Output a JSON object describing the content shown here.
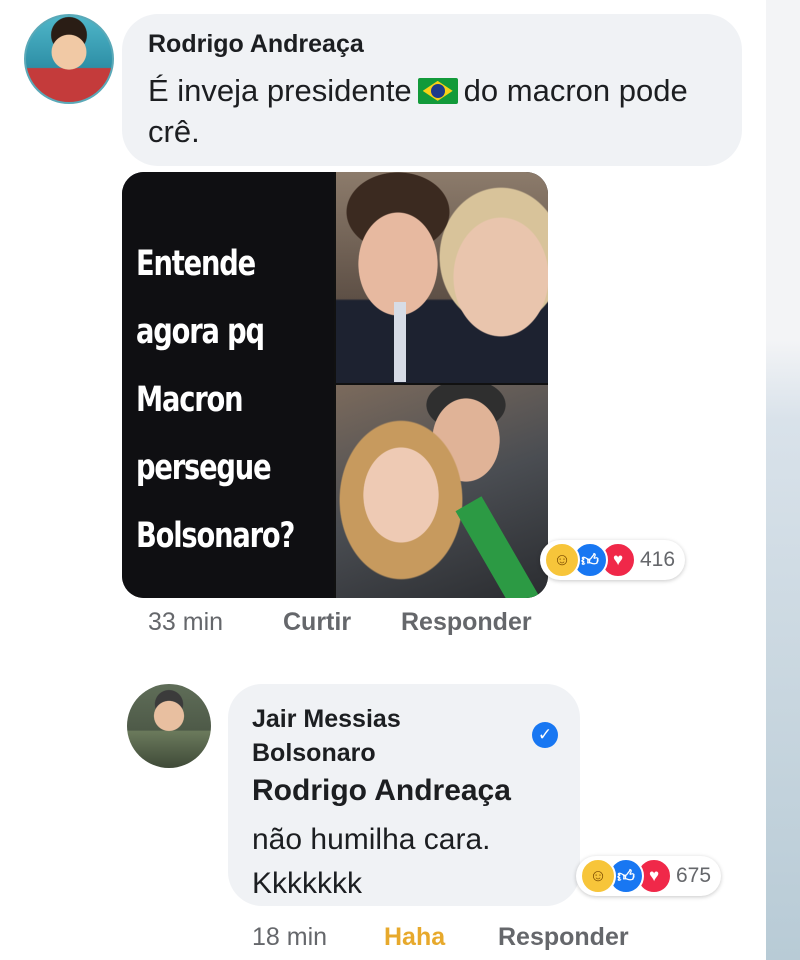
{
  "comment1": {
    "author": "Rodrigo Andreaça",
    "text_before_flag": "É inveja presidente",
    "flag_icon": "brazil-flag-icon",
    "text_after_flag": "do macron pode crê.",
    "meme_text": "Entende agora pq Macron persegue Bolsonaro?",
    "reactions": {
      "icons": [
        "haha-icon",
        "like-icon",
        "love-icon"
      ],
      "count": "416"
    },
    "time": "33 min",
    "like_label": "Curtir",
    "reply_label": "Responder"
  },
  "comment2": {
    "author": "Jair Messias Bolsonaro",
    "verified": true,
    "mention": "Rodrigo Andreaça",
    "text": "não humilha cara. Kkkkkkk",
    "reactions": {
      "icons": [
        "haha-icon",
        "like-icon",
        "love-icon"
      ],
      "count": "675"
    },
    "time": "18 min",
    "reaction_label": "Haha",
    "reply_label": "Responder"
  },
  "colors": {
    "bubble": "#f0f2f5",
    "haha_active": "#e7a92c",
    "like_blue": "#1877f2",
    "love_red": "#f02849",
    "meta_gray": "#65676b"
  }
}
